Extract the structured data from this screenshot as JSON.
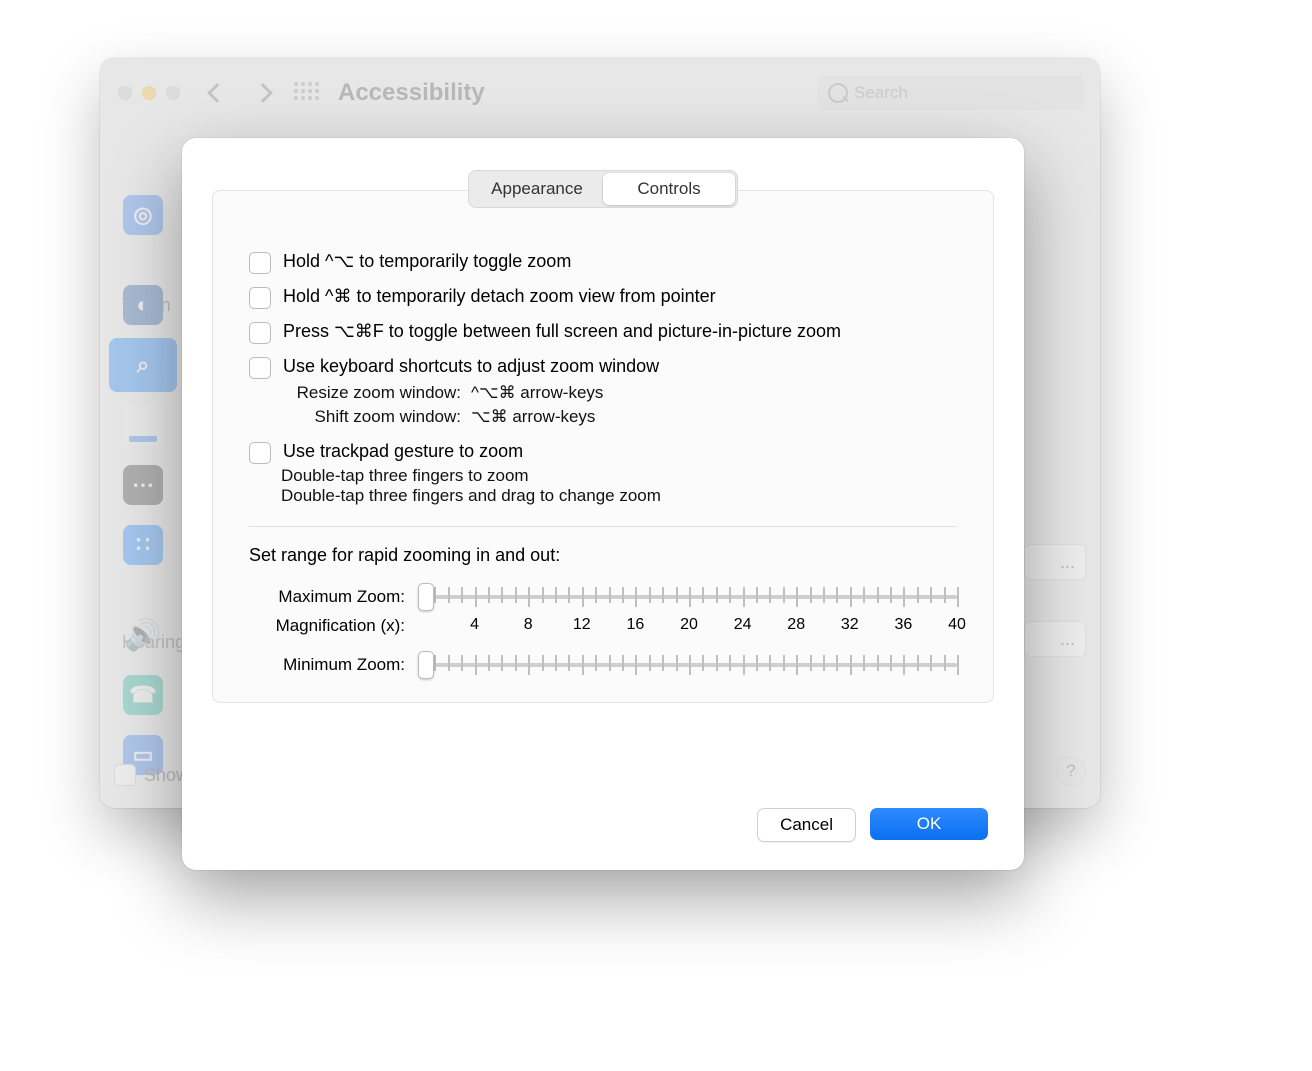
{
  "window": {
    "title": "Accessibility",
    "search_placeholder": "Search"
  },
  "sidebar": {
    "label_vision": "Vision",
    "label_hearing": "Hearing",
    "show_label": "Show"
  },
  "bg_buttons": {
    "b1": "...",
    "b2": "...",
    "help": "?"
  },
  "tabs": {
    "appearance": "Appearance",
    "controls": "Controls"
  },
  "options": {
    "hold_ctrl_opt": "Hold ^⌥ to temporarily toggle zoom",
    "hold_ctrl_cmd": "Hold ^⌘ to temporarily detach zoom view from pointer",
    "press_opt_cmd_f": "Press ⌥⌘F to toggle between full screen and picture-in-picture zoom",
    "kb_shortcuts": "Use keyboard shortcuts to adjust zoom window",
    "kb_resize_label": "Resize zoom window:",
    "kb_resize_keys": "^⌥⌘ arrow-keys",
    "kb_shift_label": "Shift zoom window:",
    "kb_shift_keys": "⌥⌘ arrow-keys",
    "trackpad": "Use trackpad gesture to zoom",
    "trackpad_l1": "Double-tap three fingers to zoom",
    "trackpad_l2": "Double-tap three fingers and drag to change zoom"
  },
  "range": {
    "title": "Set range for rapid zooming in and out:",
    "max_label": "Maximum Zoom:",
    "mag_label": "Magnification (x):",
    "min_label": "Minimum Zoom:",
    "scale": {
      "n4": "4",
      "n8": "8",
      "n12": "12",
      "n16": "16",
      "n20": "20",
      "n24": "24",
      "n28": "28",
      "n32": "32",
      "n36": "36",
      "n40": "40"
    },
    "max_value_pct": 1,
    "min_value_pct": 1
  },
  "footer": {
    "cancel": "Cancel",
    "ok": "OK"
  }
}
